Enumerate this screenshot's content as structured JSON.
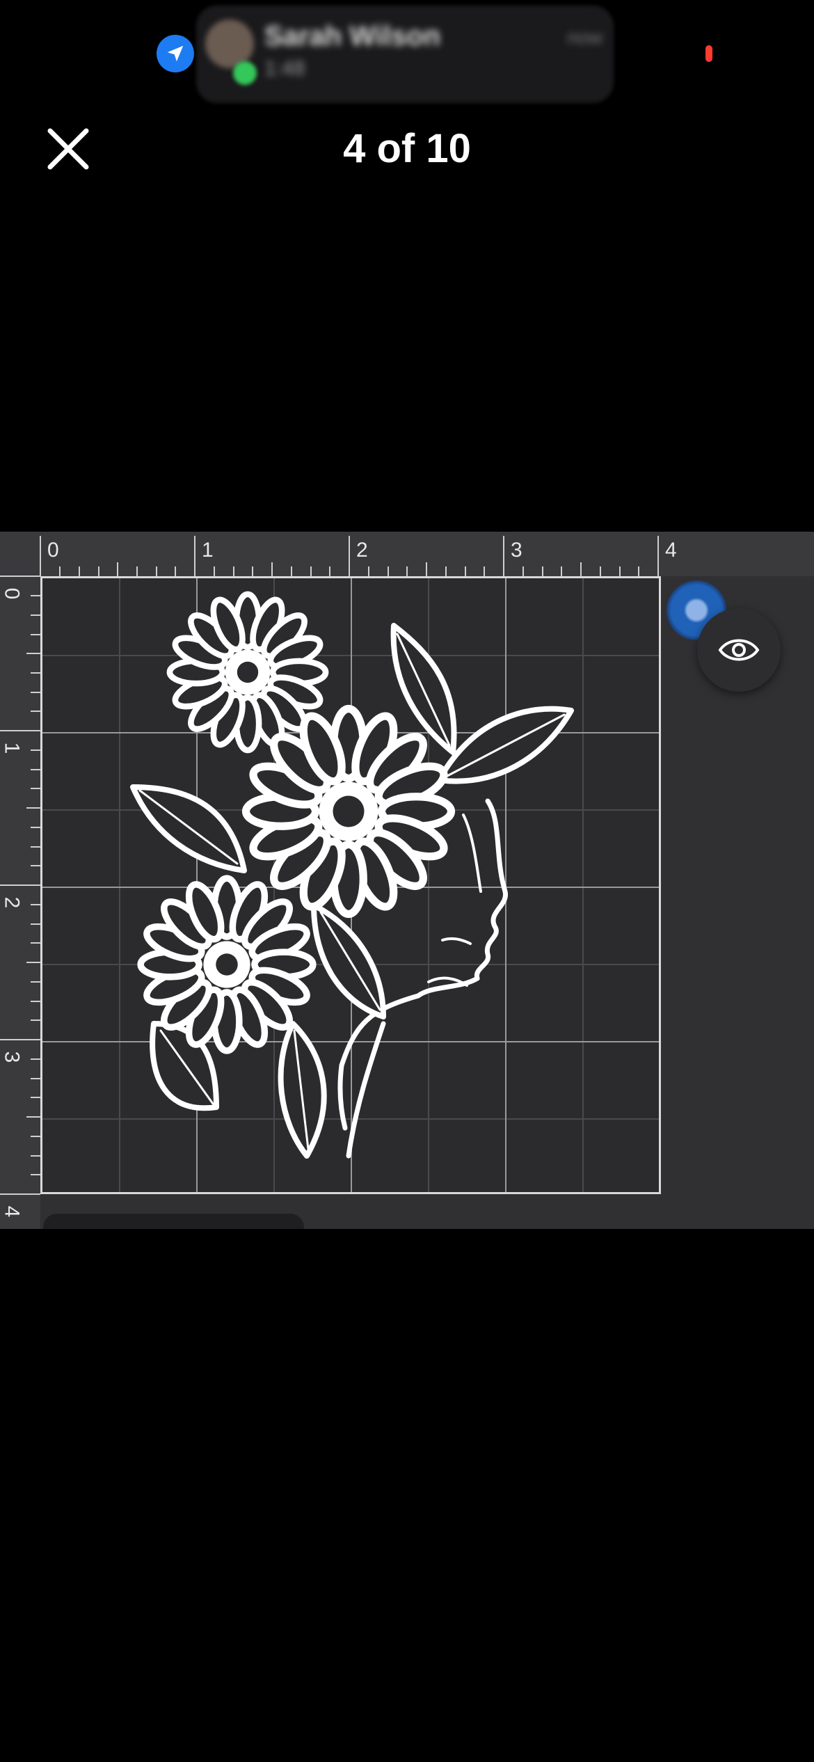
{
  "status_bar": {
    "location_icon": "location-arrow-icon",
    "notification": {
      "title": "Sarah Wilson",
      "subtitle": "1:48",
      "time": "now"
    },
    "recording_color": "#ff3b30"
  },
  "viewer": {
    "counter": "4 of 10",
    "close_icon": "close-icon"
  },
  "photo": {
    "ruler_top_labels": [
      "0",
      "1",
      "2",
      "3",
      "4"
    ],
    "ruler_left_labels": [
      "0",
      "1",
      "2",
      "3",
      "4"
    ],
    "eye_icon": "eye-icon",
    "design": "floral-woman-silhouette"
  },
  "colors": {
    "background": "#000000",
    "accent_blue": "#1e7cf2",
    "mat": "#2b2b2d"
  }
}
